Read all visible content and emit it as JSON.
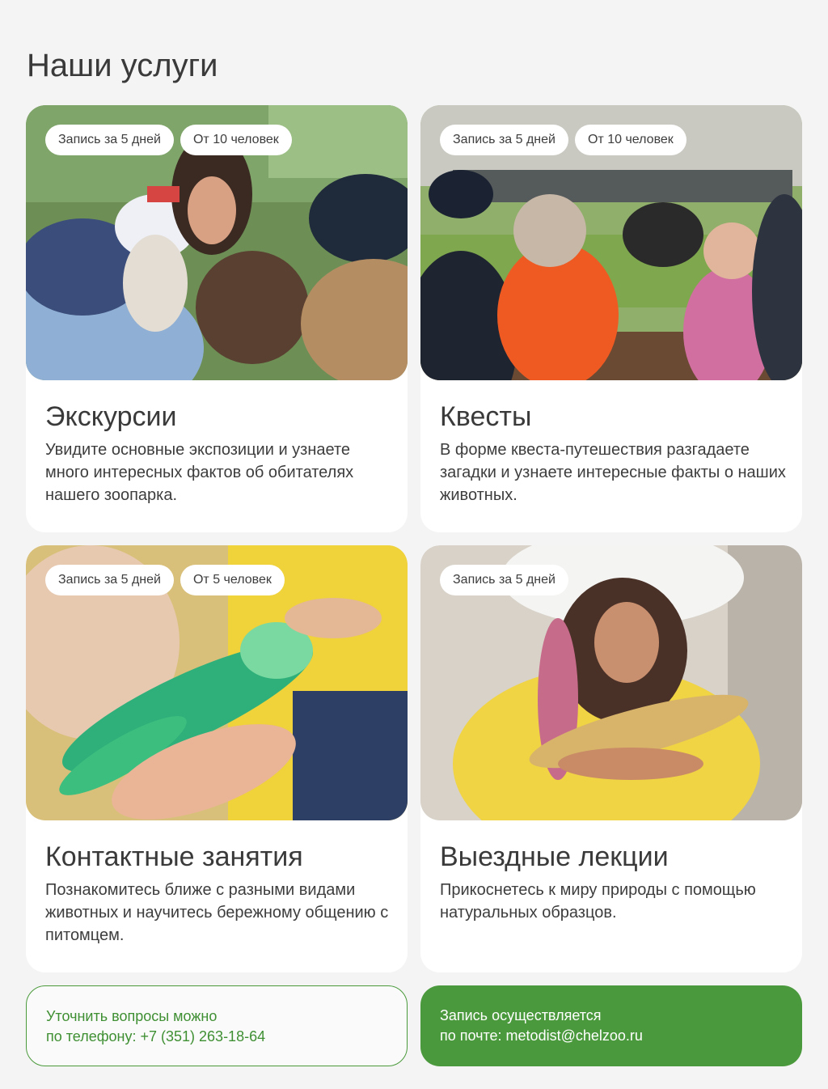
{
  "page": {
    "title": "Наши услуги"
  },
  "services": [
    {
      "tags": [
        "Запись за 5 дней",
        "От 10 человек"
      ],
      "title": "Экскурсии",
      "description": "Увидите основные экспозиции и узнаете много интересных фактов об обитателях нашего зоопарка."
    },
    {
      "tags": [
        "Запись за 5 дней",
        "От 10 человек"
      ],
      "title": "Квесты",
      "description": "В форме квеста-путешествия разгадаете загадки и узнаете интересные факты о наших животных."
    },
    {
      "tags": [
        "Запись за 5 дней",
        "От 5 человек"
      ],
      "title": "Контактные занятия",
      "description": "Познакомитесь ближе с разными видами животных и научитесь бережному общению с питомцем."
    },
    {
      "tags": [
        "Запись за 5 дней"
      ],
      "title": "Выездные лекции",
      "description": "Прикоснетесь к миру природы с помощью натуральных образцов."
    }
  ],
  "contacts": {
    "phone_line1": "Уточнить вопросы можно",
    "phone_line2": "по телефону: +7 (351) 263-18-64",
    "email_line1": "Запись осуществляется",
    "email_line2": "по почте: metodist@chelzoo.ru"
  },
  "colors": {
    "accent": "#4b993d",
    "background": "#f4f4f4",
    "card": "#ffffff"
  }
}
